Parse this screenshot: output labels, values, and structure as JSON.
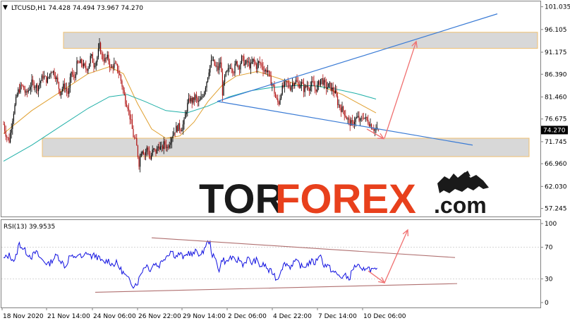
{
  "header": {
    "symbol_line": "LTCUSD,H1  74.428 74.494 73.967 74.270",
    "rsi_label": "RSI(13) 39.9535"
  },
  "watermark": {
    "part1": "TOR",
    "part2": "FOREX",
    "part3": ".com",
    "color_dark": "#1a1a1a",
    "color_accent": "#e8401c"
  },
  "colors": {
    "candle_up": "#000000",
    "candle_down": "#b01010",
    "ma_fast": "#e0a030",
    "ma_slow": "#20b0a8",
    "trend_blue": "#3a7bd5",
    "arrow_red": "#f07070",
    "zone_fill": "#d8d8d8",
    "zone_border": "#f0c070",
    "rsi_line": "#1010e0",
    "rsi_channel": "#b07070",
    "current_price_bg": "#000000"
  },
  "chart_data": [
    {
      "type": "candlestick",
      "symbol": "LTCUSD",
      "timeframe": "H1",
      "last_bar": {
        "open": 74.428,
        "high": 74.494,
        "low": 73.967,
        "close": 74.27
      },
      "current_price": "74.270",
      "y_ticks": [
        "101.035",
        "96.105",
        "91.175",
        "86.390",
        "81.460",
        "76.675",
        "71.745",
        "66.960",
        "62.030",
        "57.245"
      ],
      "y_tick_values": [
        101.035,
        96.105,
        91.175,
        86.39,
        81.46,
        76.675,
        71.745,
        66.96,
        62.03,
        57.245
      ],
      "ylim": [
        55.5,
        102.2
      ],
      "x_ticks": [
        "18 Nov 2020",
        "21 Nov 14:00",
        "24 Nov 06:00",
        "26 Nov 22:00",
        "29 Nov 14:00",
        "2 Dec 06:00",
        "4 Dec 22:00",
        "7 Dec 14:00",
        "10 Dec 06:00"
      ],
      "price_path": [
        [
          0,
          75.5
        ],
        [
          4,
          73.0
        ],
        [
          8,
          72.0
        ],
        [
          14,
          78.0
        ],
        [
          20,
          82.5
        ],
        [
          26,
          84.0
        ],
        [
          32,
          82.0
        ],
        [
          40,
          84.5
        ],
        [
          48,
          83.5
        ],
        [
          56,
          86.0
        ],
        [
          62,
          85.0
        ],
        [
          68,
          87.5
        ],
        [
          74,
          86.0
        ],
        [
          80,
          82.5
        ],
        [
          86,
          84.0
        ],
        [
          92,
          82.0
        ],
        [
          96,
          87.0
        ],
        [
          100,
          85.0
        ],
        [
          104,
          88.5
        ],
        [
          110,
          89.0
        ],
        [
          116,
          87.5
        ],
        [
          120,
          88.0
        ],
        [
          124,
          90.5
        ],
        [
          128,
          88.5
        ],
        [
          132,
          89.5
        ],
        [
          136,
          92.5
        ],
        [
          140,
          90.0
        ],
        [
          144,
          89.5
        ],
        [
          148,
          90.0
        ],
        [
          152,
          87.5
        ],
        [
          156,
          88.5
        ],
        [
          160,
          88.0
        ],
        [
          164,
          86.5
        ],
        [
          168,
          84.0
        ],
        [
          172,
          81.0
        ],
        [
          176,
          79.5
        ],
        [
          180,
          76.5
        ],
        [
          184,
          73.0
        ],
        [
          188,
          71.5
        ],
        [
          192,
          67.0
        ],
        [
          196,
          70.5
        ],
        [
          200,
          69.0
        ],
        [
          204,
          70.5
        ],
        [
          208,
          68.0
        ],
        [
          212,
          70.0
        ],
        [
          216,
          69.5
        ],
        [
          220,
          71.0
        ],
        [
          224,
          70.0
        ],
        [
          228,
          71.5
        ],
        [
          232,
          70.5
        ],
        [
          236,
          72.0
        ],
        [
          240,
          73.5
        ],
        [
          244,
          74.5
        ],
        [
          248,
          75.0
        ],
        [
          252,
          74.5
        ],
        [
          256,
          76.0
        ],
        [
          260,
          79.5
        ],
        [
          264,
          81.0
        ],
        [
          268,
          80.5
        ],
        [
          272,
          81.5
        ],
        [
          276,
          80.0
        ],
        [
          280,
          81.0
        ],
        [
          284,
          82.5
        ],
        [
          288,
          85.0
        ],
        [
          292,
          88.0
        ],
        [
          296,
          89.5
        ],
        [
          300,
          88.0
        ],
        [
          304,
          87.5
        ],
        [
          308,
          89.5
        ],
        [
          310,
          82.0
        ],
        [
          314,
          86.0
        ],
        [
          318,
          87.0
        ],
        [
          322,
          88.5
        ],
        [
          326,
          87.0
        ],
        [
          330,
          89.0
        ],
        [
          334,
          88.0
        ],
        [
          338,
          90.0
        ],
        [
          342,
          88.5
        ],
        [
          346,
          89.0
        ],
        [
          350,
          88.0
        ],
        [
          354,
          89.5
        ],
        [
          358,
          88.0
        ],
        [
          362,
          89.0
        ],
        [
          366,
          88.5
        ],
        [
          370,
          87.0
        ],
        [
          374,
          87.5
        ],
        [
          378,
          85.0
        ],
        [
          382,
          84.0
        ],
        [
          386,
          81.0
        ],
        [
          390,
          80.0
        ],
        [
          394,
          83.0
        ],
        [
          398,
          84.0
        ],
        [
          402,
          84.5
        ],
        [
          406,
          83.5
        ],
        [
          410,
          84.5
        ],
        [
          414,
          85.0
        ],
        [
          418,
          84.0
        ],
        [
          422,
          84.5
        ],
        [
          426,
          83.0
        ],
        [
          430,
          84.0
        ],
        [
          434,
          83.5
        ],
        [
          438,
          84.5
        ],
        [
          442,
          83.0
        ],
        [
          446,
          84.0
        ],
        [
          450,
          85.5
        ],
        [
          454,
          84.5
        ],
        [
          458,
          83.5
        ],
        [
          462,
          84.0
        ],
        [
          466,
          83.0
        ],
        [
          470,
          82.5
        ],
        [
          474,
          80.0
        ],
        [
          478,
          79.0
        ],
        [
          482,
          78.5
        ],
        [
          486,
          77.0
        ],
        [
          490,
          76.0
        ],
        [
          494,
          75.5
        ],
        [
          498,
          76.5
        ],
        [
          502,
          77.0
        ],
        [
          506,
          76.0
        ],
        [
          510,
          77.5
        ],
        [
          514,
          76.5
        ],
        [
          518,
          76.0
        ],
        [
          522,
          75.0
        ],
        [
          526,
          74.5
        ],
        [
          530,
          74.27
        ]
      ],
      "ma_fast_path": [
        [
          0,
          73.5
        ],
        [
          40,
          78.5
        ],
        [
          80,
          82.5
        ],
        [
          120,
          86.5
        ],
        [
          150,
          88.0
        ],
        [
          170,
          86.5
        ],
        [
          190,
          80.0
        ],
        [
          210,
          74.5
        ],
        [
          230,
          72.5
        ],
        [
          250,
          73.0
        ],
        [
          270,
          76.0
        ],
        [
          290,
          80.5
        ],
        [
          310,
          84.0
        ],
        [
          330,
          86.0
        ],
        [
          360,
          87.0
        ],
        [
          390,
          85.5
        ],
        [
          420,
          84.0
        ],
        [
          450,
          83.8
        ],
        [
          480,
          82.0
        ],
        [
          510,
          79.5
        ],
        [
          528,
          78.0
        ]
      ],
      "ma_slow_path": [
        [
          0,
          67.5
        ],
        [
          40,
          71.0
        ],
        [
          80,
          75.0
        ],
        [
          120,
          79.0
        ],
        [
          150,
          81.5
        ],
        [
          175,
          82.0
        ],
        [
          200,
          80.5
        ],
        [
          230,
          78.5
        ],
        [
          260,
          78.0
        ],
        [
          290,
          79.5
        ],
        [
          320,
          81.5
        ],
        [
          350,
          82.8
        ],
        [
          380,
          83.5
        ],
        [
          410,
          83.9
        ],
        [
          440,
          83.9
        ],
        [
          470,
          83.2
        ],
        [
          500,
          82.2
        ],
        [
          528,
          81.0
        ]
      ],
      "resistance_zone": [
        92.0,
        95.5
      ],
      "support_zone": [
        68.5,
        72.5
      ],
      "trendline_upper": [
        [
          308,
          80.5
        ],
        [
          705,
          99.5
        ]
      ],
      "trendline_lower": [
        [
          308,
          80.5
        ],
        [
          670,
          71.0
        ]
      ],
      "arrow_up": [
        [
          545,
          72.5
        ],
        [
          590,
          93.5
        ]
      ],
      "arrow_down": [
        [
          520,
          74.5
        ],
        [
          544,
          72.4
        ]
      ]
    },
    {
      "type": "line",
      "name": "RSI(13)",
      "current_value": 39.9535,
      "y_ticks": [
        "100",
        "70",
        "30",
        "0"
      ],
      "y_tick_values": [
        100,
        70,
        30,
        0
      ],
      "ylim": [
        0,
        100
      ],
      "rsi_path": [
        [
          0,
          55
        ],
        [
          8,
          60
        ],
        [
          16,
          52
        ],
        [
          22,
          75
        ],
        [
          28,
          68
        ],
        [
          34,
          62
        ],
        [
          40,
          58
        ],
        [
          46,
          64
        ],
        [
          52,
          56
        ],
        [
          58,
          52
        ],
        [
          64,
          48
        ],
        [
          70,
          55
        ],
        [
          76,
          60
        ],
        [
          82,
          52
        ],
        [
          88,
          45
        ],
        [
          94,
          60
        ],
        [
          100,
          55
        ],
        [
          106,
          62
        ],
        [
          112,
          55
        ],
        [
          118,
          64
        ],
        [
          124,
          58
        ],
        [
          130,
          60
        ],
        [
          136,
          55
        ],
        [
          142,
          50
        ],
        [
          148,
          54
        ],
        [
          154,
          48
        ],
        [
          160,
          50
        ],
        [
          166,
          42
        ],
        [
          172,
          35
        ],
        [
          178,
          28
        ],
        [
          184,
          22
        ],
        [
          190,
          25
        ],
        [
          196,
          40
        ],
        [
          202,
          48
        ],
        [
          208,
          42
        ],
        [
          214,
          50
        ],
        [
          220,
          46
        ],
        [
          226,
          55
        ],
        [
          232,
          60
        ],
        [
          238,
          66
        ],
        [
          244,
          58
        ],
        [
          250,
          62
        ],
        [
          256,
          56
        ],
        [
          262,
          64
        ],
        [
          268,
          60
        ],
        [
          274,
          66
        ],
        [
          280,
          58
        ],
        [
          286,
          72
        ],
        [
          292,
          78
        ],
        [
          296,
          60
        ],
        [
          302,
          52
        ],
        [
          306,
          40
        ],
        [
          310,
          56
        ],
        [
          316,
          50
        ],
        [
          322,
          58
        ],
        [
          328,
          52
        ],
        [
          334,
          55
        ],
        [
          340,
          48
        ],
        [
          346,
          56
        ],
        [
          352,
          50
        ],
        [
          358,
          54
        ],
        [
          364,
          46
        ],
        [
          370,
          48
        ],
        [
          376,
          40
        ],
        [
          382,
          38
        ],
        [
          388,
          28
        ],
        [
          394,
          44
        ],
        [
          400,
          50
        ],
        [
          406,
          45
        ],
        [
          412,
          52
        ],
        [
          418,
          50
        ],
        [
          424,
          44
        ],
        [
          430,
          48
        ],
        [
          436,
          52
        ],
        [
          442,
          50
        ],
        [
          448,
          62
        ],
        [
          454,
          48
        ],
        [
          460,
          46
        ],
        [
          466,
          40
        ],
        [
          472,
          36
        ],
        [
          478,
          32
        ],
        [
          484,
          34
        ],
        [
          490,
          30
        ],
        [
          496,
          44
        ],
        [
          502,
          48
        ],
        [
          508,
          38
        ],
        [
          514,
          46
        ],
        [
          520,
          42
        ],
        [
          526,
          40
        ],
        [
          530,
          39.95
        ]
      ],
      "channel_upper": [
        [
          215,
          82
        ],
        [
          645,
          57
        ]
      ],
      "channel_lower": [
        [
          135,
          13
        ],
        [
          648,
          24
        ]
      ],
      "arrow_down": [
        [
          522,
          40
        ],
        [
          545,
          25
        ]
      ],
      "arrow_up": [
        [
          545,
          25
        ],
        [
          578,
          92
        ]
      ]
    }
  ]
}
